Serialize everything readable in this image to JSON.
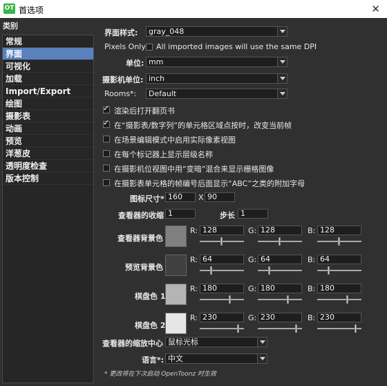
{
  "window": {
    "app_icon_text": "OT",
    "title": "首选项",
    "close_glyph": "✕"
  },
  "sidebar": {
    "heading": "类别",
    "items": [
      {
        "label": "常规",
        "selected": false
      },
      {
        "label": "界面",
        "selected": true
      },
      {
        "label": "可视化",
        "selected": false
      },
      {
        "label": "加载",
        "selected": false
      },
      {
        "label": "Import/Export",
        "selected": false
      },
      {
        "label": "绘图",
        "selected": false
      },
      {
        "label": "摄影表",
        "selected": false
      },
      {
        "label": "动画",
        "selected": false
      },
      {
        "label": "预览",
        "selected": false
      },
      {
        "label": "洋葱皮",
        "selected": false
      },
      {
        "label": "透明度检查",
        "selected": false
      },
      {
        "label": "版本控制",
        "selected": false
      }
    ]
  },
  "form": {
    "style_label": "界面样式:",
    "style_value": "gray_048",
    "pixels_only_label": "Pixels Only:",
    "pixels_only_text": "All imported images will use the same DPI",
    "pixels_only_checked": false,
    "units_label": "单位:",
    "units_value": "mm",
    "camera_units_label": "摄影机单位:",
    "camera_units_value": "inch",
    "rooms_label": "Rooms*:",
    "rooms_value": "Default",
    "checkboxes": [
      {
        "label": "渲染后打开翻页书",
        "checked": true
      },
      {
        "label": "在“摄影表/数字列”的单元格区域点按时，改变当前帧",
        "checked": true
      },
      {
        "label": "在场景编辑模式中启用实际像素视图",
        "checked": false
      },
      {
        "label": "在每个标记器上显示层级名称",
        "checked": false
      },
      {
        "label": "在摄影机位视图中用“变暗”混合来显示栅格图像",
        "checked": false
      },
      {
        "label": "在摄影表单元格的帧编号后面显示“ABC”之类的附加字母",
        "checked": false
      }
    ],
    "icon_size_label": "图标尺寸*",
    "icon_size_w": "160",
    "icon_size_x": "X",
    "icon_size_h": "90",
    "viewer_shrink_label": "查看器的收缩",
    "viewer_shrink_value": "1",
    "step_label": "步长",
    "step_value": "1",
    "zoom_center_label": "查看器的缩放中心",
    "zoom_center_value": "鼠标光标",
    "language_label": "语言*:",
    "language_value": "中文",
    "footnote": "* 更改将在下次启动 OpenToonz 时生效"
  },
  "colors": [
    {
      "label": "查看器背景色",
      "swatch": "#808080",
      "r": "128",
      "g": "128",
      "b": "128",
      "r_level": 0.502,
      "g_level": 0.502,
      "b_level": 0.502
    },
    {
      "label": "预览背景色",
      "swatch": "#404040",
      "r": "64",
      "g": "64",
      "b": "64",
      "r_level": 0.251,
      "g_level": 0.251,
      "b_level": 0.251
    },
    {
      "label": "棋盘色 1",
      "swatch": "#b4b4b4",
      "r": "180",
      "g": "180",
      "b": "180",
      "r_level": 0.706,
      "g_level": 0.706,
      "b_level": 0.706
    },
    {
      "label": "棋盘色 2",
      "swatch": "#e6e6e6",
      "r": "230",
      "g": "230",
      "b": "230",
      "r_level": 0.902,
      "g_level": 0.902,
      "b_level": 0.902
    }
  ],
  "channel_labels": {
    "r": "R:",
    "g": "G:",
    "b": "B:"
  },
  "theme": {
    "selected_bg": "#5a81bd",
    "panel_bg": "#303030"
  }
}
